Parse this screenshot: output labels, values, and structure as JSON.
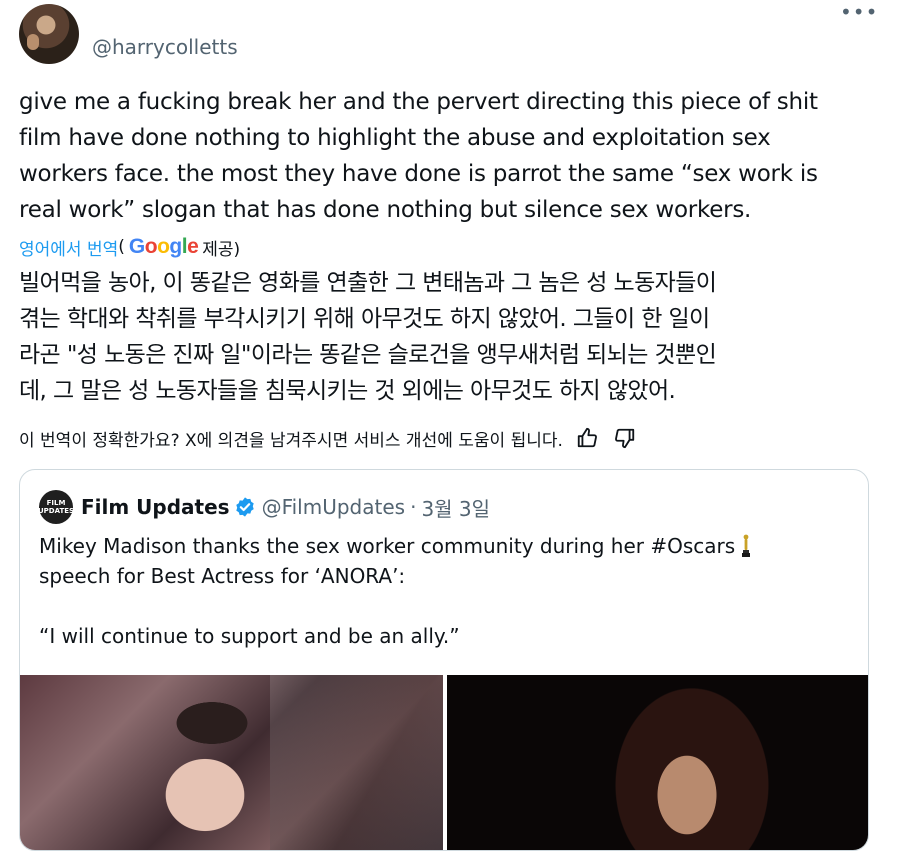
{
  "tweet": {
    "handle": "@harrycolletts",
    "more_label": "•••",
    "text": "give me a fucking break her and the pervert directing this piece of shit\nfilm have done nothing to highlight the abuse and exploitation sex\nworkers face. the most they have done is parrot the same “sex work is\nreal work” slogan that has done nothing but silence sex workers.",
    "translate_link": "영어에서 번역",
    "translate_open": "(",
    "translate_provider": "Google",
    "translate_suffix": " 제공)",
    "translated_text": "빌어먹을 농아, 이 똥같은 영화를 연출한 그 변태놈과 그 놈은 성 노동자들이\n겪는 학대와 착취를 부각시키기 위해 아무것도 하지 않았어. 그들이 한 일이\n라곤 \"성 노동은 진짜 일\"이라는 똥같은 슬로건을 앵무새처럼 되뇌는 것뿐인\n데, 그 말은 성 노동자들을 침묵시키는 것 외에는 아무것도 하지 않았어.",
    "feedback_prompt": "이 번역이 정확한가요? X에 의견을 남겨주시면 서비스 개선에 도움이 됩니다."
  },
  "quote": {
    "avatar_text": "FILM UPDATES",
    "name": "Film Updates",
    "handle": "@FilmUpdates",
    "separator": "·",
    "date": "3월 3일",
    "text": "Mikey Madison thanks the sex worker community during her #Oscars\nspeech for Best Actress for ‘ANORA’:\n\n“I will continue to support and be an ally.”"
  },
  "colors": {
    "link": "#1d9bf0",
    "secondary_text": "#536471",
    "verified": "#1d9bf0",
    "border": "#cfd9de"
  }
}
